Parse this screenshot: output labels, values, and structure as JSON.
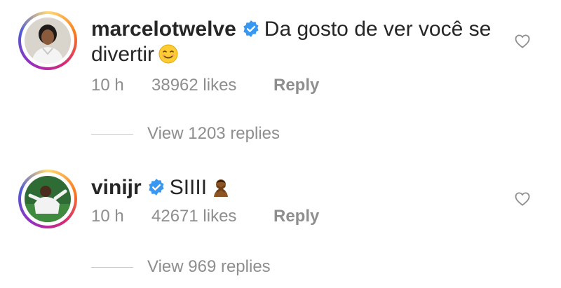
{
  "comments": [
    {
      "username": "marcelotwelve",
      "verified": true,
      "text_line1": "Da gosto de ver você se",
      "text_line2": "divertir",
      "emoji": "smiling-face-icon",
      "time": "10 h",
      "likes": "38962 likes",
      "reply_label": "Reply",
      "view_replies": "View 1203 replies"
    },
    {
      "username": "vinijr",
      "verified": true,
      "text_line1": "SIIII",
      "emoji": "shushing-person-icon",
      "time": "10 h",
      "likes": "42671 likes",
      "reply_label": "Reply",
      "view_replies": "View 969 replies"
    }
  ],
  "colors": {
    "text": "#262626",
    "muted": "#8e8e8e",
    "verified": "#3897f0",
    "ring": [
      "#feda75",
      "#fa7e1e",
      "#d62976",
      "#962fbf",
      "#4f5bd5"
    ]
  }
}
